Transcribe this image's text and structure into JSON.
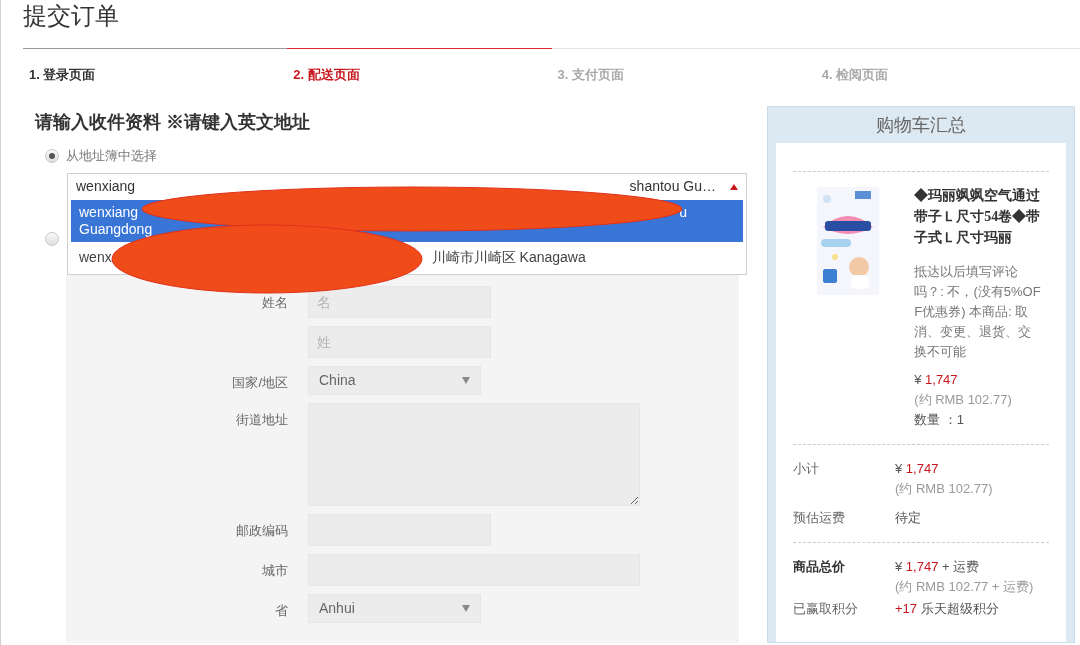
{
  "page_title": "提交订单",
  "steps": [
    {
      "label": "1. 登录页面",
      "selected": false,
      "completed": true
    },
    {
      "label": "2. 配送页面",
      "selected": true,
      "completed": false
    },
    {
      "label": "3. 支付页面",
      "selected": false,
      "completed": false
    },
    {
      "label": "4. 检阅页面",
      "selected": false,
      "completed": false
    }
  ],
  "section_heading": "请输入收件资料 ※请键入英文地址",
  "address_choices": [
    {
      "label": "从地址簿中选择",
      "selected": true
    },
    {
      "selected": false
    }
  ],
  "address_select": {
    "start": "wenxiang",
    "end": "shantou Gu…",
    "expanded": true,
    "options": [
      {
        "start": "wenxiang",
        "end": "u",
        "second_line": "Guangdong",
        "selected": true
      },
      {
        "start": "wenx",
        "end": "川崎市川崎区 Kanagawa",
        "selected": false
      }
    ]
  },
  "form_fields": [
    {
      "kind": "text",
      "label": "姓名",
      "placeholder": "名",
      "wide": false
    },
    {
      "kind": "text",
      "placeholder": "姓",
      "wide": false
    },
    {
      "kind": "select",
      "label": "国家/地区",
      "value": "China"
    },
    {
      "kind": "textarea",
      "label": "街道地址"
    },
    {
      "kind": "text",
      "label": "邮政编码",
      "wide": false
    },
    {
      "kind": "text",
      "label": "城市",
      "wide": true
    },
    {
      "kind": "select",
      "label": "省",
      "value": "Anhui"
    }
  ],
  "cart": {
    "title": "购物车汇总",
    "item": {
      "kind": "picture",
      "name": "◆玛丽飒飒空气通过带子Ｌ尺寸54卷◆带子式Ｌ尺寸玛丽",
      "note": "抵达以后填写评论吗？: 不，(没有5%OFF优惠券) 本商品: 取消、变更、退货、交换不可能",
      "currency": "¥",
      "price": "1,747",
      "approx": "(约 RMB 102.77)",
      "quantity": "数量 ：1"
    },
    "summary": [
      {
        "kind": "price",
        "label": "小计",
        "currency": "¥",
        "price": "1,747",
        "approx": "(约 RMB 102.77)"
      },
      {
        "kind": "text",
        "label": "预估运费",
        "value": "待定"
      }
    ],
    "totals": [
      {
        "kind": "price",
        "label": "商品总价",
        "bold": true,
        "currency": "¥",
        "price": "1,747",
        "suffix": "+ 运费",
        "approx": "(约 RMB 102.77 + 运费)"
      },
      {
        "kind": "points",
        "label": "已赢取积分",
        "bold": false,
        "points": "+17",
        "suffix": "乐天超级积分"
      }
    ]
  }
}
